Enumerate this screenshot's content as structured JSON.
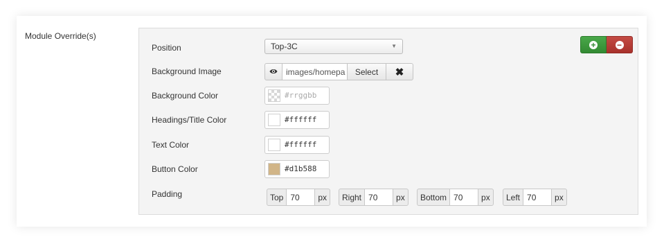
{
  "module_override_label": "Module Override(s)",
  "position": {
    "label": "Position",
    "selected": "Top-3C"
  },
  "background_image": {
    "label": "Background Image",
    "value": "images/homepa",
    "select_label": "Select",
    "clear_icon": "✖",
    "eye_icon": "eye-icon"
  },
  "background_color": {
    "label": "Background Color",
    "placeholder": "#rrggbb"
  },
  "headings_color": {
    "label": "Headings/Title Color",
    "value": "#ffffff",
    "swatch": "#ffffff"
  },
  "text_color": {
    "label": "Text Color",
    "value": "#ffffff",
    "swatch": "#ffffff"
  },
  "button_color": {
    "label": "Button Color",
    "value": "#d1b588",
    "swatch": "#d1b588"
  },
  "padding": {
    "label": "Padding",
    "top": {
      "label": "Top",
      "value": "70",
      "unit": "px"
    },
    "right": {
      "label": "Right",
      "value": "70",
      "unit": "px"
    },
    "bottom": {
      "label": "Bottom",
      "value": "70",
      "unit": "px"
    },
    "left": {
      "label": "Left",
      "value": "70",
      "unit": "px"
    }
  },
  "actions": {
    "add_icon": "+",
    "remove_icon": "−",
    "add_color": "#338a33",
    "remove_color": "#a8312b"
  }
}
